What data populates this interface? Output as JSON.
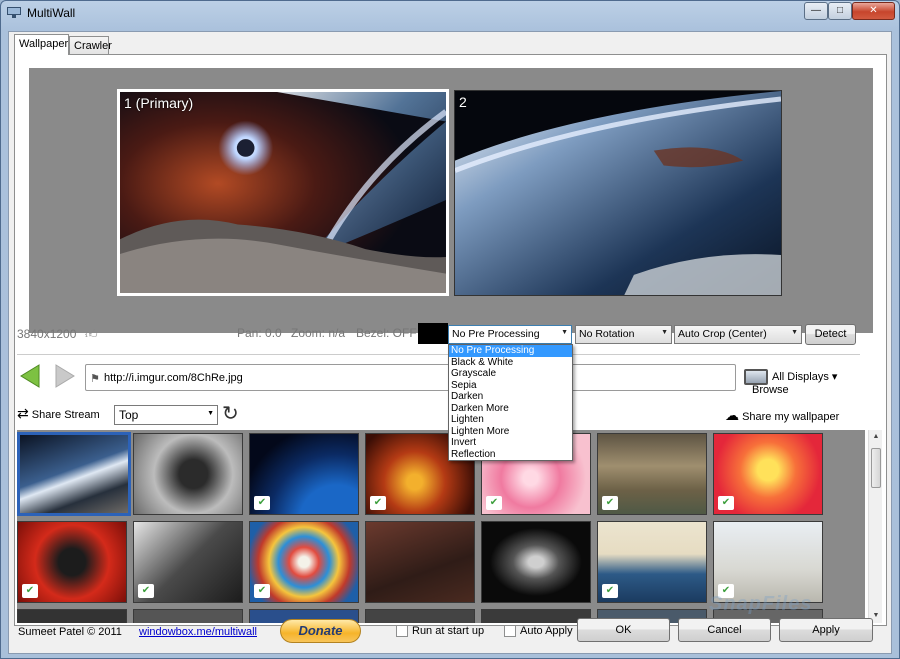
{
  "window": {
    "title": "MultiWall",
    "min": "0",
    "max": "1",
    "close": "r"
  },
  "tabs": [
    {
      "label": "Wallpaper",
      "active": true
    },
    {
      "label": "Crawler",
      "active": false
    }
  ],
  "monitors": [
    {
      "label": "1 (Primary)"
    },
    {
      "label": "2"
    }
  ],
  "controls": {
    "resolution": "3840x1200",
    "pan": "Pan: 0.0",
    "zoom": "Zoom: n/a",
    "bezel": "Bezel: OFF",
    "pre_processing": "No Pre Processing",
    "rotation": "No Rotation",
    "crop": "Auto Crop (Center)",
    "detect": "Detect"
  },
  "pre_processing_options": [
    "No Pre Processing",
    "Black & White",
    "Grayscale",
    "Sepia",
    "Darken",
    "Darken More",
    "Lighten",
    "Lighten More",
    "Invert",
    "Reflection"
  ],
  "url_bar": {
    "value": "http://i.imgur.com/8ChRe.jpg",
    "browse": "Browse"
  },
  "displays": "All Displays",
  "stream": {
    "share_stream": "Share Stream",
    "sort": "Top",
    "share_wallpaper": "Share my wallpaper"
  },
  "footer": {
    "credit": "Sumeet Patel © 2011",
    "link": "windowbox.me/multiwall",
    "donate": "Donate",
    "run_at_startup": "Run at start up",
    "auto_apply": "Auto Apply",
    "ok": "OK",
    "cancel": "Cancel",
    "apply": "Apply"
  },
  "watermark": "SnapFiles",
  "colors": {
    "accent": "#3399ff",
    "selection_border": "#2c62b8",
    "like_green": "#3fa03f"
  }
}
